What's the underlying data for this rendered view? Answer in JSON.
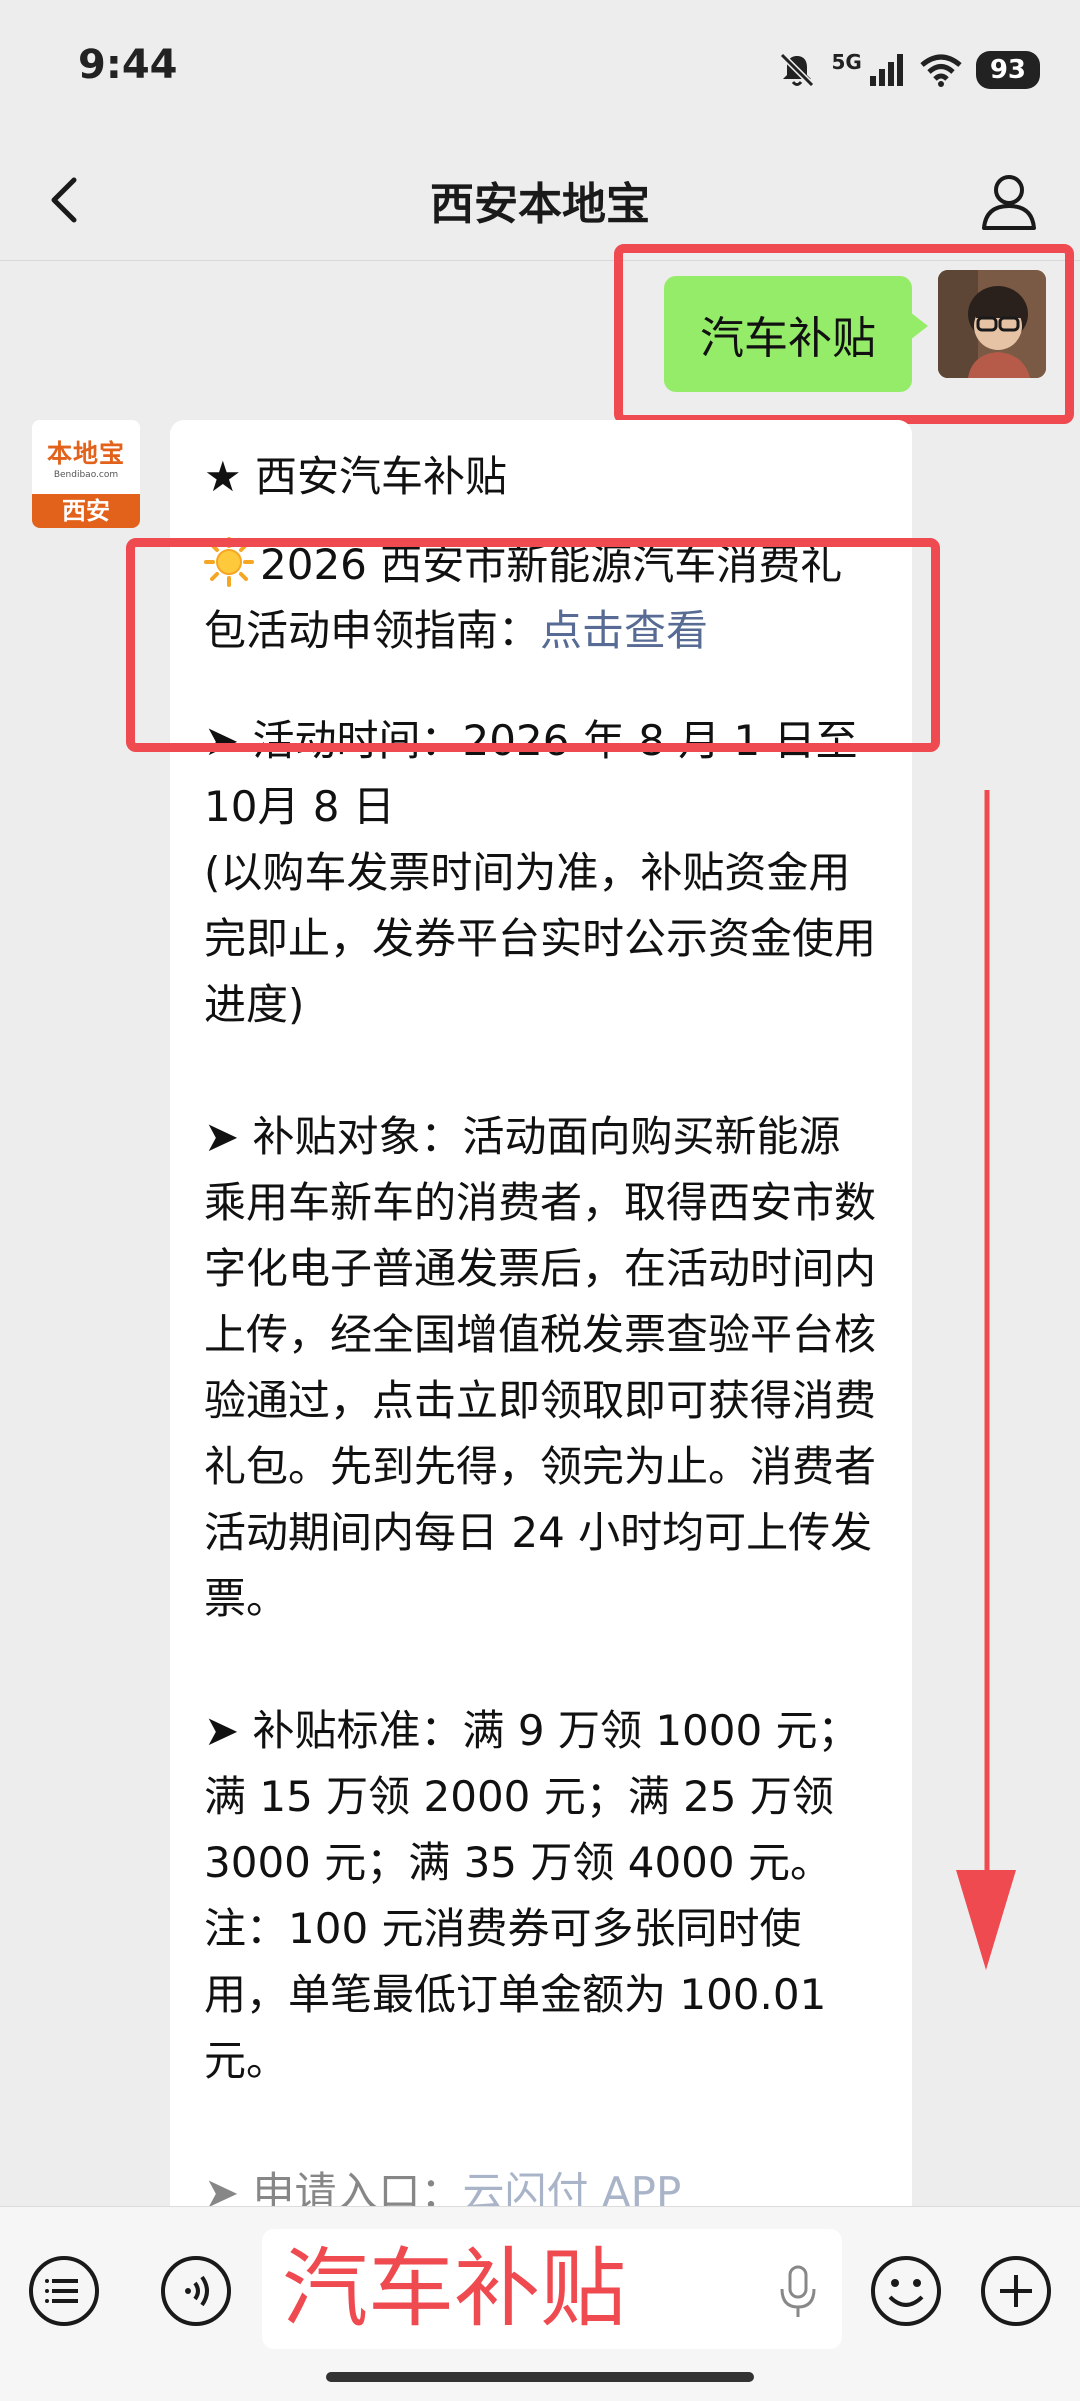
{
  "status_bar": {
    "time": "9:44",
    "network": "5G",
    "battery": "93",
    "icons": [
      "mute-bell-icon",
      "signal-icon",
      "wifi-icon",
      "battery-icon"
    ]
  },
  "header": {
    "title": "西安本地宝",
    "back_icon": "chevron-left-icon",
    "profile_icon": "user-icon"
  },
  "messages": {
    "outgoing": {
      "text": "汽车补贴"
    },
    "incoming": {
      "sender_logo": "本地宝",
      "sender_logo_url": "Bendibao.com",
      "sender_city": "西安",
      "heading": "★ 西安汽车补贴",
      "guide_text": "2026 西安市新能源汽车消费礼包活动申领指南：",
      "guide_link": "点击查看",
      "time_title": "➤ 活动时间：2026 年 8 月 1 日至 10月 8 日",
      "time_note": "(以购车发票时间为准，补贴资金用完即止，发券平台实时公示资金使用进度)",
      "target": "➤ 补贴对象：活动面向购买新能源乘用车新车的消费者，取得西安市数字化电子普通发票后，在活动时间内上传，经全国增值税发票查验平台核验通过，点击立即领取即可获得消费礼包。先到先得，领完为止。消费者活动期间内每日 24 小时均可上传发票。",
      "standard": "➤ 补贴标准：满 9 万领 1000 元；满 15 万领 2000 元；满 25 万领 3000 元；满 35 万领 4000 元。",
      "note": "注：100 元消费券可多张同时使用，单笔最低订单金额为 100.01 元。",
      "cutoff_prefix": "➤ 申请入口：",
      "cutoff_link": "云闪付 APP"
    }
  },
  "annotations": {
    "color": "#ef4a50"
  },
  "input_bar": {
    "text": "汽车补贴",
    "menu_icon": "menu-list-icon",
    "voice_icon": "voice-wave-icon",
    "mic_icon": "microphone-icon",
    "emoji_icon": "emoji-icon",
    "plus_icon": "plus-icon"
  },
  "colors": {
    "outgoing_bubble": "#95ec69",
    "link": "#576b95",
    "background": "#ededed"
  }
}
